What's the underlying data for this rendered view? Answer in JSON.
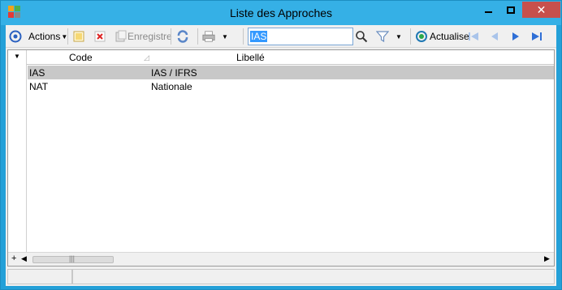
{
  "window": {
    "title": "Liste des Approches",
    "controls": [
      "minimize",
      "maximize",
      "close"
    ]
  },
  "toolbar": {
    "actions_label": "Actions",
    "save_label": "Enregistre",
    "refresh_label": "Actualise",
    "search_value": "IAS"
  },
  "grid": {
    "columns": [
      "Code",
      "Libellé"
    ],
    "rows": [
      {
        "code": "IAS",
        "label": "IAS / IFRS",
        "selected": true
      },
      {
        "code": "NAT",
        "label": "Nationale",
        "selected": false
      }
    ],
    "footer_plus": "+"
  },
  "icons": {
    "minimize": "minimize-icon",
    "maximize": "maximize-icon",
    "close": "close-icon"
  }
}
